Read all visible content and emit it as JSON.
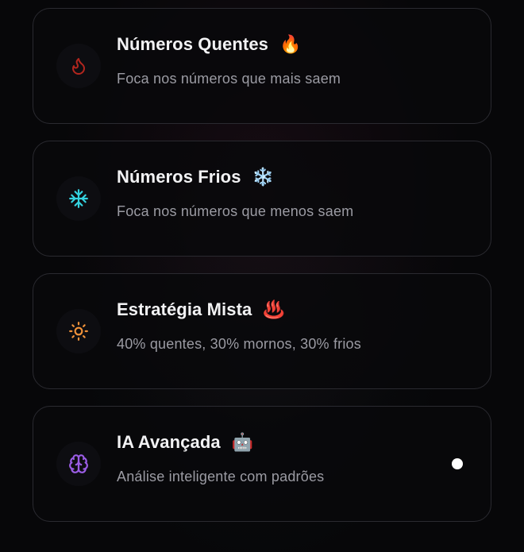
{
  "options": [
    {
      "title": "Números Quentes",
      "emoji": "🔥",
      "description": "Foca nos números que mais saem",
      "icon": "flame-icon",
      "icon_color": "#b3261e",
      "selected": false
    },
    {
      "title": "Números Frios",
      "emoji": "❄️",
      "description": "Foca nos números que menos saem",
      "icon": "snowflake-icon",
      "icon_color": "#34d3e0",
      "selected": false
    },
    {
      "title": "Estratégia Mista",
      "emoji": "♨️",
      "description": "40% quentes, 30% mornos, 30% frios",
      "icon": "sun-icon",
      "icon_color": "#f0923a",
      "selected": false
    },
    {
      "title": "IA Avançada",
      "emoji": "🤖",
      "description": "Análise inteligente com padrões",
      "icon": "brain-icon",
      "icon_color": "#9b5de5",
      "selected": true
    }
  ]
}
